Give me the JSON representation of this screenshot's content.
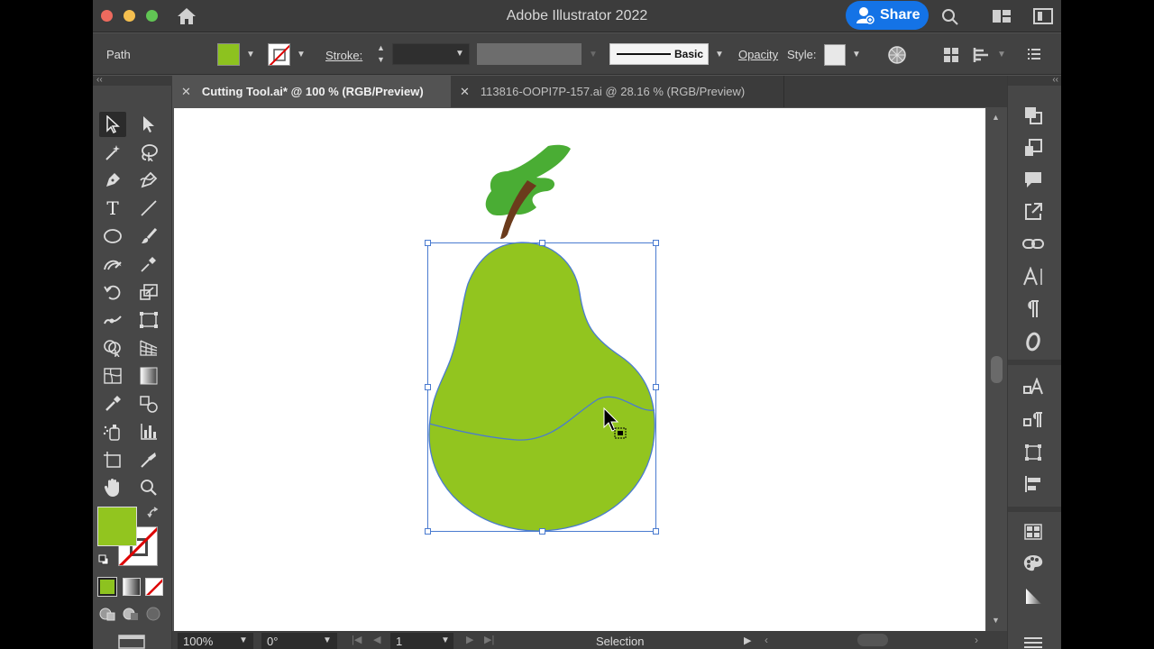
{
  "window": {
    "title": "Adobe Illustrator 2022",
    "share_label": "Share"
  },
  "control_bar": {
    "selection_type": "Path",
    "fill_color": "#8dc21f",
    "stroke_label": "Stroke:",
    "brush_label": "Basic",
    "opacity_label": "Opacity",
    "style_label": "Style:"
  },
  "tabs": [
    {
      "label": "Cutting Tool.ai* @ 100 % (RGB/Preview)",
      "active": true
    },
    {
      "label": "113816-OOPI7P-157.ai @ 28.16 % (RGB/Preview)",
      "active": false
    }
  ],
  "status_bar": {
    "zoom": "100%",
    "rotation": "0°",
    "artboard_number": "1",
    "current_tool": "Selection"
  },
  "colors": {
    "pear": "#92c51f",
    "leaf": "#4aad34",
    "stem": "#6b3b1c",
    "selection": "#4a7bd0",
    "accent": "#1473e6"
  }
}
